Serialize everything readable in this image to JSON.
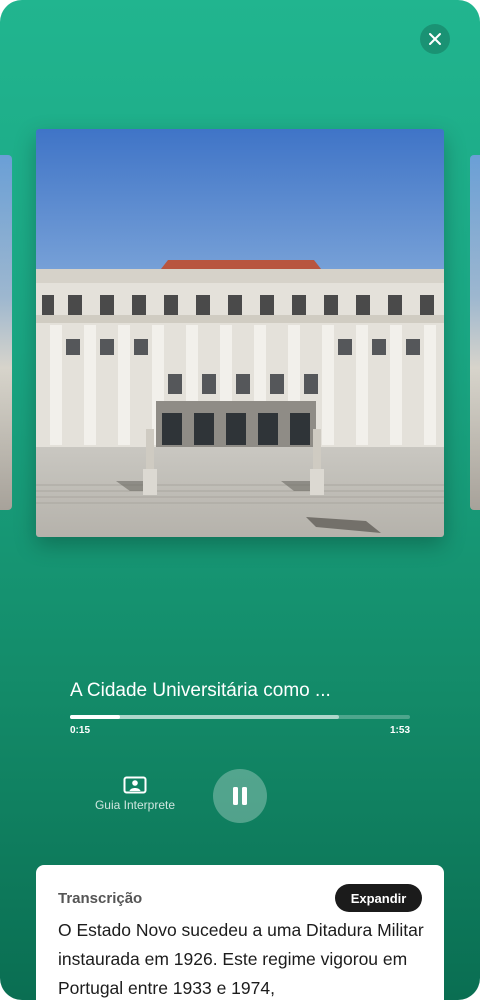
{
  "player": {
    "close_icon": "close-icon",
    "track_title": "A Cidade Universitária como ...",
    "progress": {
      "buffered_fraction": 0.79,
      "played_fraction": 0.147
    },
    "current_time": "0:15",
    "total_time": "1:53",
    "guide_button": {
      "icon": "person-frame-icon",
      "label": "Guia Interprete"
    },
    "pause_icon": "pause-icon"
  },
  "transcript": {
    "title": "Transcrição",
    "expand_label": "Expandir",
    "text": "O Estado Novo sucedeu a uma Ditadura Militar instaurada em 1926. Este regime vigorou em Portugal entre 1933 e 1974,"
  },
  "colors": {
    "gradient_top": "#21b58f",
    "gradient_bottom": "#0a6e52",
    "card_background": "#ffffff",
    "expand_button": "#1b1b1b"
  }
}
